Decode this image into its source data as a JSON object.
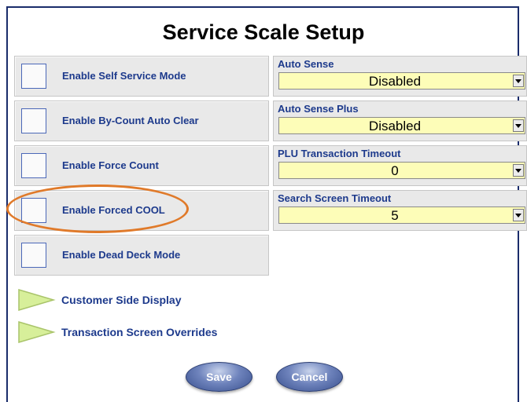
{
  "title": "Service Scale Setup",
  "checkboxes": [
    {
      "label": "Enable Self Service Mode",
      "checked": false
    },
    {
      "label": "Enable By-Count Auto Clear",
      "checked": false
    },
    {
      "label": "Enable Force Count",
      "checked": false
    },
    {
      "label": "Enable Forced COOL",
      "checked": false
    },
    {
      "label": "Enable Dead Deck Mode",
      "checked": false
    }
  ],
  "dropdowns": [
    {
      "label": "Auto Sense",
      "value": "Disabled"
    },
    {
      "label": "Auto Sense Plus",
      "value": "Disabled"
    },
    {
      "label": "PLU Transaction Timeout",
      "value": "0"
    },
    {
      "label": "Search Screen Timeout",
      "value": "5"
    }
  ],
  "sections": [
    {
      "label": "Customer Side Display",
      "icon": "triangle-expand-icon"
    },
    {
      "label": "Transaction Screen Overrides",
      "icon": "triangle-expand-icon"
    }
  ],
  "buttons": {
    "save": "Save",
    "cancel": "Cancel"
  },
  "colors": {
    "label_blue": "#1d3a8c",
    "dropdown_bg": "#fdfdb8",
    "highlight": "#e07a2a",
    "expander_green": "#d7ef9a"
  }
}
